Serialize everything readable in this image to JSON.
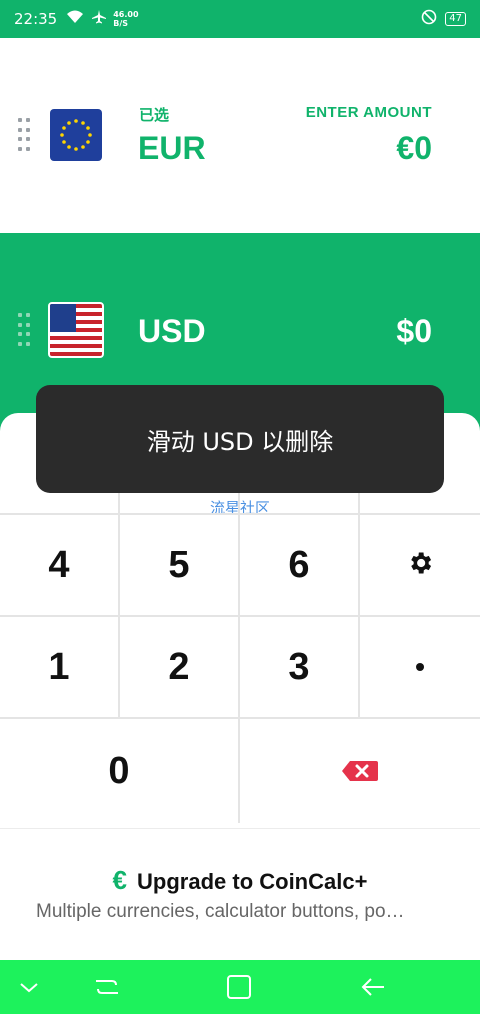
{
  "status": {
    "time": "22:35",
    "rate_top": "46.00",
    "rate_bottom": "B/S",
    "battery": "47"
  },
  "from": {
    "label": "已选",
    "code": "EUR",
    "enter_label": "ENTER AMOUNT",
    "amount": "€0",
    "flag": "eu-flag-icon"
  },
  "to": {
    "code": "USD",
    "amount": "$0",
    "flag": "us-flag-icon"
  },
  "toast": {
    "text": "滑动 USD 以删除"
  },
  "watermark": "流星社区",
  "keypad": {
    "k4": "4",
    "k5": "5",
    "k6": "6",
    "k1": "1",
    "k2": "2",
    "k3": "3",
    "k0": "0",
    "dot": "•",
    "settings_icon": "gear-icon",
    "backspace_icon": "backspace-icon"
  },
  "upgrade": {
    "icon": "€",
    "title": "Upgrade to CoinCalc+",
    "subtitle": "Multiple currencies, calculator buttons, po…"
  },
  "colors": {
    "brand": "#10b36b",
    "nav": "#1df25c",
    "toast": "#2b2b2b",
    "backspace": "#e5334b"
  }
}
